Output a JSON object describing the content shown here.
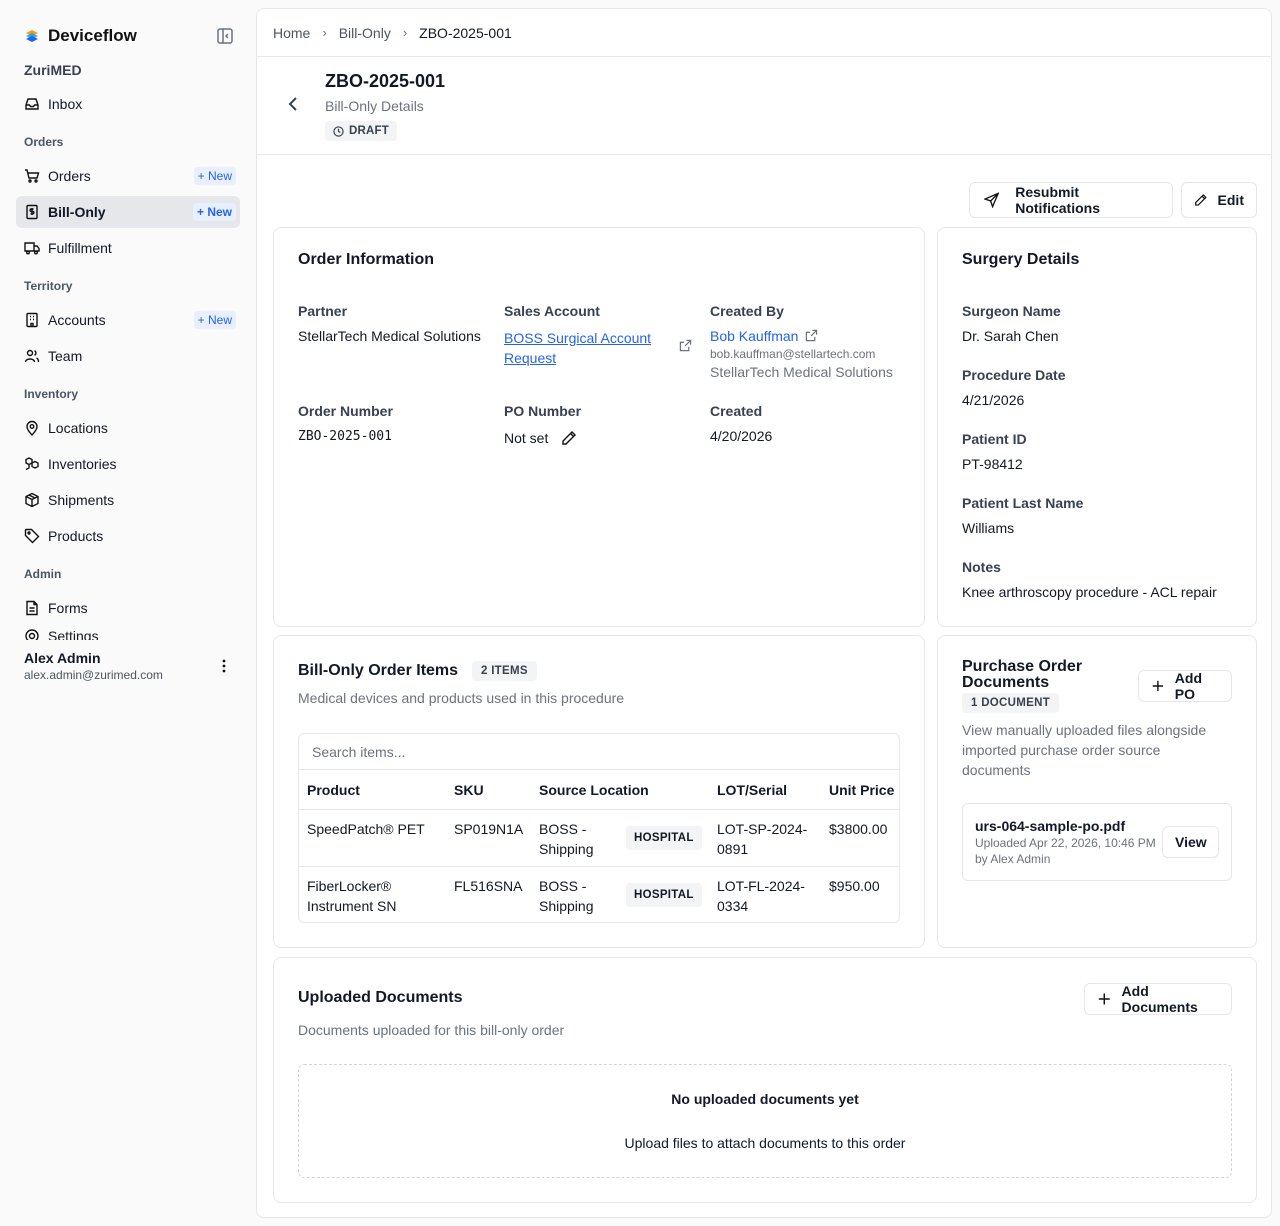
{
  "brand": {
    "name": "Deviceflow",
    "org": "ZuriMED"
  },
  "sidebar": {
    "items": [
      {
        "label": "Inbox",
        "icon": "inbox-icon"
      },
      {
        "group": "Orders"
      },
      {
        "label": "Orders",
        "icon": "cart-icon",
        "badge": "New"
      },
      {
        "label": "Bill-Only",
        "icon": "receipt-icon",
        "badge": "New",
        "active": true
      },
      {
        "label": "Fulfillment",
        "icon": "truck-icon"
      },
      {
        "group": "Territory"
      },
      {
        "label": "Accounts",
        "icon": "building-icon",
        "badge": "New"
      },
      {
        "label": "Team",
        "icon": "users-icon"
      },
      {
        "group": "Inventory"
      },
      {
        "label": "Locations",
        "icon": "map-pin-icon"
      },
      {
        "label": "Inventories",
        "icon": "boxes-icon"
      },
      {
        "label": "Shipments",
        "icon": "package-icon"
      },
      {
        "label": "Products",
        "icon": "tag-icon"
      },
      {
        "group": "Admin"
      },
      {
        "label": "Forms",
        "icon": "form-icon"
      },
      {
        "label": "Settings",
        "icon": "gear-icon"
      }
    ]
  },
  "user": {
    "name": "Alex Admin",
    "email": "alex.admin@zurimed.com"
  },
  "breadcrumb": [
    "Home",
    "Bill-Only",
    "ZBO-2025-001"
  ],
  "header": {
    "title": "ZBO-2025-001",
    "subtitle": "Bill-Only Details",
    "status": "DRAFT"
  },
  "actions": {
    "resubmit": "Resubmit Notifications",
    "edit": "Edit"
  },
  "order_info": {
    "title": "Order Information",
    "partner_label": "Partner",
    "partner": "StellarTech Medical Solutions",
    "sales_account_label": "Sales Account",
    "sales_account_line1": "BOSS Surgical Account",
    "sales_account_line2": "Request",
    "created_by_label": "Created By",
    "created_by": "Bob Kauffman",
    "created_by_email": "bob.kauffman@stellartech.com",
    "created_by_org": "StellarTech Medical Solutions",
    "order_number_label": "Order Number",
    "order_number": "ZBO-2025-001",
    "po_number_label": "PO Number",
    "po_number": "Not set",
    "created_label": "Created",
    "created": "4/20/2026"
  },
  "surgery": {
    "title": "Surgery Details",
    "surgeon_label": "Surgeon Name",
    "surgeon": "Dr. Sarah Chen",
    "procedure_date_label": "Procedure Date",
    "procedure_date": "4/21/2026",
    "patient_id_label": "Patient ID",
    "patient_id": "PT-98412",
    "patient_last_label": "Patient Last Name",
    "patient_last": "Williams",
    "notes_label": "Notes",
    "notes": "Knee arthroscopy procedure - ACL repair"
  },
  "items": {
    "title": "Bill-Only Order Items",
    "count": "2 ITEMS",
    "subtitle": "Medical devices and products used in this procedure",
    "search_placeholder": "Search items...",
    "columns": [
      "Product",
      "SKU",
      "Source Location",
      "LOT/Serial",
      "Unit Price"
    ],
    "rows": [
      {
        "product1": "SpeedPatch® PET",
        "product2": "",
        "sku": "SP019N1A",
        "loc1": "BOSS -",
        "loc2": "Shipping",
        "tag": "HOSPITAL",
        "lot1": "LOT-SP-2024-",
        "lot2": "0891",
        "price": "$3800.00"
      },
      {
        "product1": "FiberLocker®",
        "product2": "Instrument SN",
        "sku": "FL516SNA",
        "loc1": "BOSS -",
        "loc2": "Shipping",
        "tag": "HOSPITAL",
        "lot1": "LOT-FL-2024-",
        "lot2": "0334",
        "price": "$950.00"
      }
    ]
  },
  "po_docs": {
    "title1": "Purchase Order",
    "title2": "Documents",
    "count": "1 DOCUMENT",
    "add": "Add PO",
    "desc1": "View manually uploaded files alongside",
    "desc2": "imported purchase order source",
    "desc3": "documents",
    "file": {
      "name": "urs-064-sample-po.pdf",
      "uploaded": "Uploaded Apr 22, 2026, 10:46 PM",
      "by": "by Alex Admin",
      "view": "View"
    }
  },
  "uploaded": {
    "title": "Uploaded Documents",
    "subtitle": "Documents uploaded for this bill-only order",
    "add": "Add Documents",
    "empty_title": "No uploaded documents yet",
    "empty_sub": "Upload files to attach documents to this order"
  }
}
